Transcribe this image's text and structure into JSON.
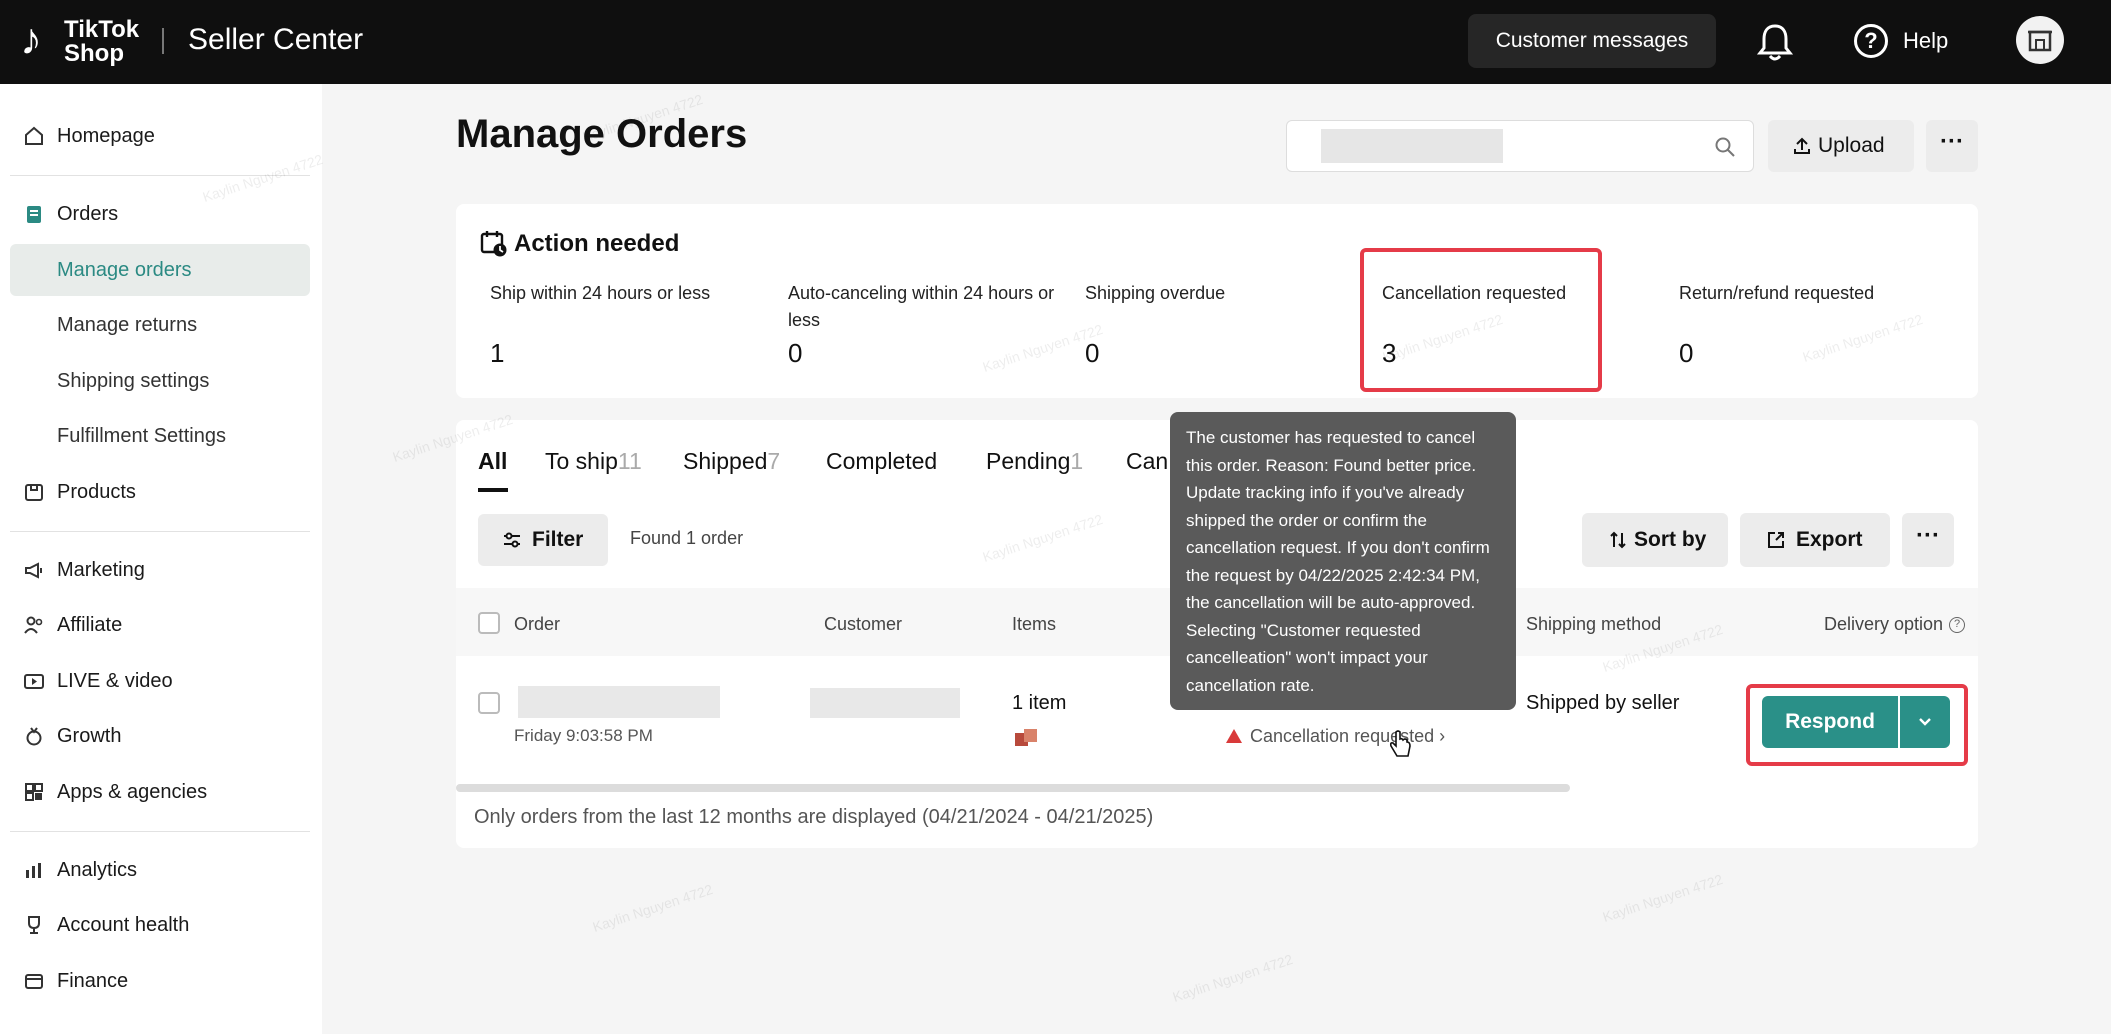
{
  "topbar": {
    "logo_line1": "TikTok",
    "logo_line2": "Shop",
    "title": "Seller Center",
    "customer_messages": "Customer messages",
    "help": "Help"
  },
  "sidebar": {
    "items": [
      {
        "label": "Homepage",
        "icon": "home-icon"
      },
      {
        "label": "Orders",
        "icon": "orders-icon"
      },
      {
        "label": "Manage orders"
      },
      {
        "label": "Manage returns"
      },
      {
        "label": "Shipping settings"
      },
      {
        "label": "Fulfillment Settings"
      },
      {
        "label": "Products",
        "icon": "products-icon"
      },
      {
        "label": "Marketing",
        "icon": "megaphone-icon"
      },
      {
        "label": "Affiliate",
        "icon": "affiliate-icon"
      },
      {
        "label": "LIVE & video",
        "icon": "video-icon"
      },
      {
        "label": "Growth",
        "icon": "growth-icon"
      },
      {
        "label": "Apps & agencies",
        "icon": "apps-icon"
      },
      {
        "label": "Analytics",
        "icon": "analytics-icon"
      },
      {
        "label": "Account health",
        "icon": "trophy-icon"
      },
      {
        "label": "Finance",
        "icon": "finance-icon"
      }
    ]
  },
  "main": {
    "title": "Manage Orders",
    "upload": "Upload",
    "more": "···",
    "action_needed": {
      "title": "Action needed",
      "metrics": [
        {
          "label": "Ship within 24 hours or less",
          "value": "1"
        },
        {
          "label": "Auto-canceling within 24 hours or less",
          "value": "0"
        },
        {
          "label": "Shipping overdue",
          "value": "0"
        },
        {
          "label": "Cancellation requested",
          "value": "3"
        },
        {
          "label": "Return/refund requested",
          "value": "0"
        }
      ]
    },
    "tabs": [
      {
        "label": "All",
        "count": ""
      },
      {
        "label": "To ship",
        "count": "11"
      },
      {
        "label": "Shipped",
        "count": "7"
      },
      {
        "label": "Completed",
        "count": ""
      },
      {
        "label": "Pending",
        "count": "1"
      },
      {
        "label": "Can",
        "count": ""
      }
    ],
    "filter": "Filter",
    "found": "Found 1 order",
    "sort_by": "Sort by",
    "export": "Export",
    "columns": {
      "order": "Order",
      "customer": "Customer",
      "items": "Items",
      "shipping_method": "Shipping method",
      "delivery_option": "Delivery option"
    },
    "row": {
      "time": "Friday 9:03:58 PM",
      "items": "1 item",
      "status": "Cancellation requested",
      "status_chevron": "›",
      "shipping_method": "Shipped by seller",
      "respond": "Respond"
    },
    "footnote": "Only orders from the last 12 months are displayed (04/21/2024 - 04/21/2025)"
  },
  "tooltip": {
    "text": "The customer has requested to cancel this order. Reason: Found better price. Update tracking info if you've already shipped the order or confirm the cancellation request. If you don't confirm the request by 04/22/2025 2:42:34 PM, the cancellation will be auto-approved. Selecting \"Customer requested cancelleation\" won't impact your cancellation rate."
  },
  "watermark": "Kaylin Nguyen 4722",
  "colors": {
    "accent": "#2a9088",
    "highlight": "#e53b48",
    "topbar": "#0f0f0f"
  }
}
